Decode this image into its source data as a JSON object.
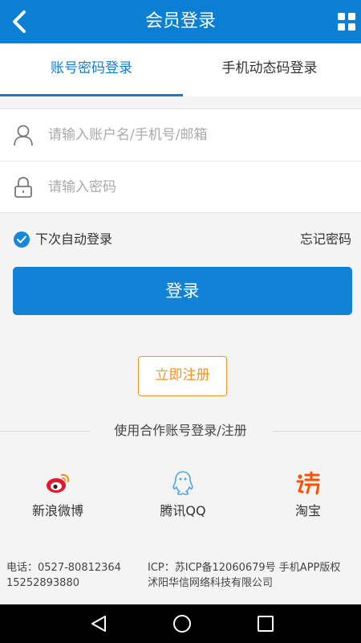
{
  "header": {
    "title": "会员登录",
    "back_icon": "chevron-left-icon",
    "menu_icon": "grid-icon"
  },
  "tabs": [
    {
      "label": "账号密码登录",
      "active": true
    },
    {
      "label": "手机动态码登录",
      "active": false
    }
  ],
  "form": {
    "account_placeholder": "请输入账户名/手机号/邮箱",
    "account_value": "",
    "password_placeholder": "请输入密码",
    "password_value": ""
  },
  "options": {
    "remember_label": "下次自动登录",
    "remember_checked": true,
    "forgot_label": "忘记密码"
  },
  "login_label": "登录",
  "register_label": "立即注册",
  "partners": {
    "title": "使用合作账号登录/注册",
    "items": [
      {
        "label": "新浪微博",
        "icon": "weibo-icon"
      },
      {
        "label": "腾讯QQ",
        "icon": "qq-icon"
      },
      {
        "label": "淘宝",
        "icon": "taobao-icon"
      }
    ]
  },
  "footer": {
    "phone_line1": "电话：0527-80812364",
    "phone_line2": "15252893880",
    "icp": "ICP：苏ICP备12060679号  手机APP版权沭阳华信网络科技有限公司"
  },
  "colors": {
    "primary": "#0b7fd3",
    "accent": "#f29322",
    "weibo": "#e6162d",
    "qq": "#4ea8e6",
    "taobao": "#ff5000"
  }
}
